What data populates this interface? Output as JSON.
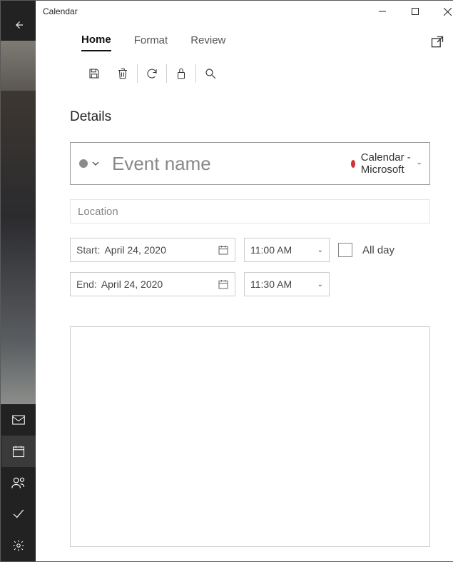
{
  "window": {
    "title": "Calendar"
  },
  "tabs": [
    {
      "label": "Home",
      "active": true
    },
    {
      "label": "Format",
      "active": false
    },
    {
      "label": "Review",
      "active": false
    }
  ],
  "toolbar": {
    "save_tooltip": "Save",
    "delete_tooltip": "Delete",
    "refresh_tooltip": "Refresh",
    "busy_tooltip": "Show as",
    "search_tooltip": "Search"
  },
  "details": {
    "heading": "Details",
    "event_name_placeholder": "Event name",
    "event_name_value": "",
    "calendar_selector_label": "Calendar - Microsoft",
    "calendar_dot_color": "#d13438",
    "location_placeholder": "Location",
    "location_value": "",
    "start": {
      "label": "Start:",
      "date": "April 24, 2020",
      "time": "11:00 AM"
    },
    "end": {
      "label": "End:",
      "date": "April 24, 2020",
      "time": "11:30 AM"
    },
    "all_day_label": "All day",
    "all_day_checked": false
  },
  "rail": {
    "items": [
      "mail",
      "calendar",
      "people",
      "todo",
      "settings"
    ],
    "active": "calendar"
  }
}
